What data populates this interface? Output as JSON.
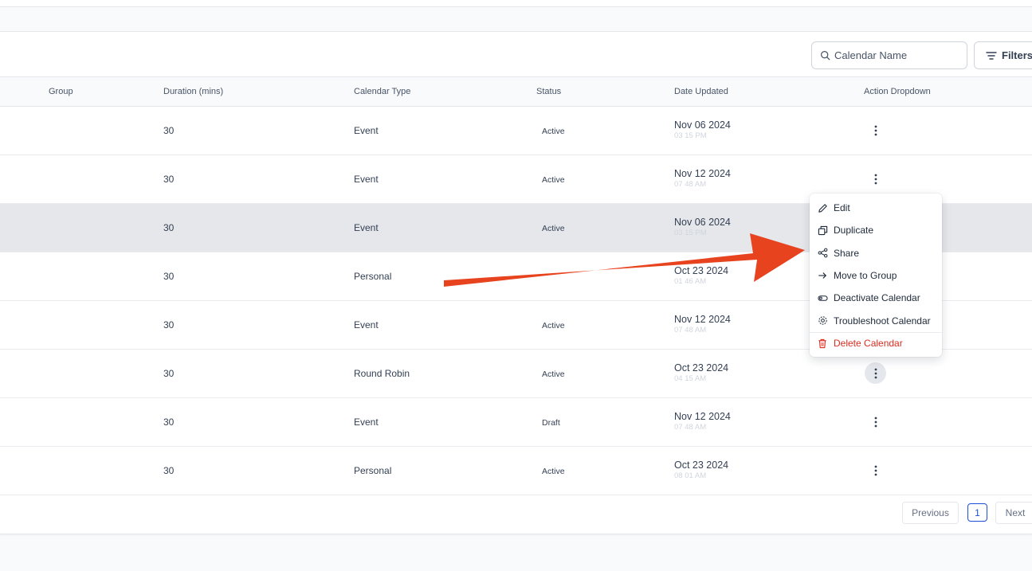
{
  "toolbar": {
    "search_placeholder": "Calendar Name",
    "filters_label": "Filters"
  },
  "table": {
    "columns": [
      "Group",
      "Duration (mins)",
      "Calendar Type",
      "Status",
      "Date Updated",
      "Action Dropdown"
    ],
    "rows": [
      {
        "duration": "30",
        "type": "Event",
        "status": "Active",
        "date": "Nov 06 2024",
        "time": "03 15 PM"
      },
      {
        "duration": "30",
        "type": "Event",
        "status": "Active",
        "date": "Nov 12 2024",
        "time": "07 48 AM"
      },
      {
        "duration": "30",
        "type": "Event",
        "status": "Active",
        "date": "Nov 06 2024",
        "time": "03 15 PM"
      },
      {
        "duration": "30",
        "type": "Personal",
        "status": "",
        "date": "Oct 23 2024",
        "time": "01 46 AM"
      },
      {
        "duration": "30",
        "type": "Event",
        "status": "Active",
        "date": "Nov 12 2024",
        "time": "07 48 AM"
      },
      {
        "duration": "30",
        "type": "Round Robin",
        "status": "Active",
        "date": "Oct 23 2024",
        "time": "04 15 AM"
      },
      {
        "duration": "30",
        "type": "Event",
        "status": "Draft",
        "date": "Nov 12 2024",
        "time": "07 48 AM"
      },
      {
        "duration": "30",
        "type": "Personal",
        "status": "Active",
        "date": "Oct 23 2024",
        "time": "08 01 AM"
      }
    ]
  },
  "menu": {
    "items": [
      {
        "label": "Edit",
        "icon": "pencil-icon"
      },
      {
        "label": "Duplicate",
        "icon": "duplicate-icon"
      },
      {
        "label": "Share",
        "icon": "share-icon"
      },
      {
        "label": "Move to Group",
        "icon": "arrow-right-icon"
      },
      {
        "label": "Deactivate Calendar",
        "icon": "toggle-icon"
      },
      {
        "label": "Troubleshoot Calendar",
        "icon": "gear-icon"
      },
      {
        "label": "Delete Calendar",
        "icon": "trash-icon"
      }
    ]
  },
  "pagination": {
    "previous_label": "Previous",
    "current_page": "1",
    "next_label": "Next"
  },
  "colors": {
    "annotation_arrow": "#e8431f",
    "danger": "#d92d20",
    "page_active": "#1d4ed8"
  }
}
